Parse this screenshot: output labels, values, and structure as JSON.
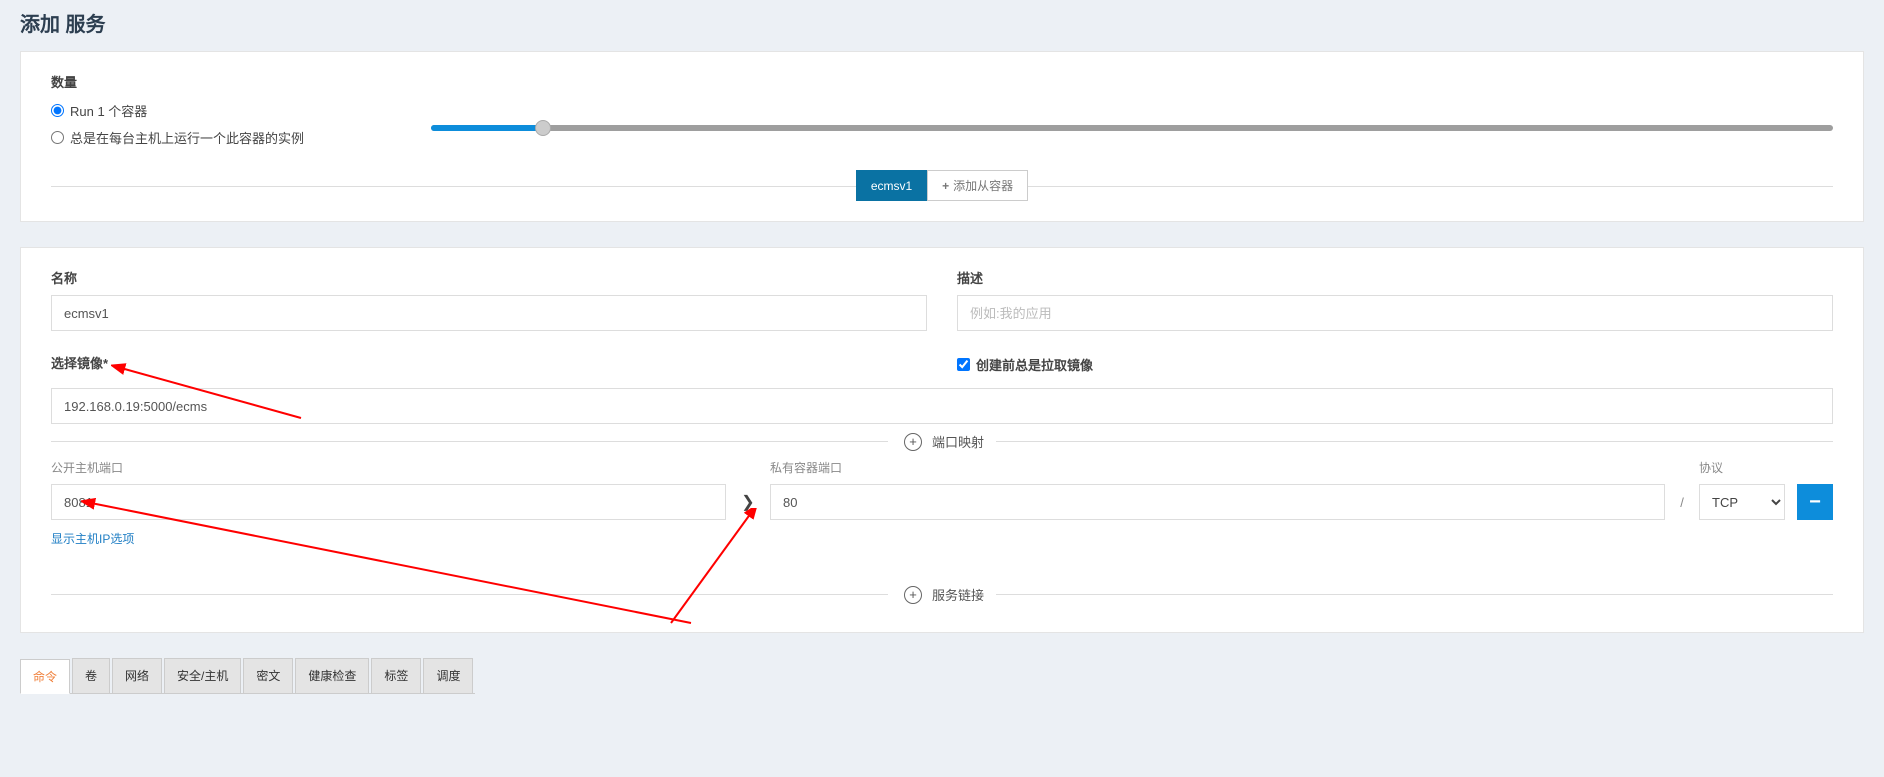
{
  "page_title": "添加 服务",
  "card1": {
    "qty_label": "数量",
    "radio_run_label": "Run 1 个容器",
    "radio_every_label": "总是在每台主机上运行一个此容器的实例",
    "slider_percent": 8,
    "pill_active": "ecmsv1",
    "pill_add": "添加从容器"
  },
  "card2": {
    "name_label": "名称",
    "name_value": "ecmsv1",
    "desc_label": "描述",
    "desc_placeholder": "例如:我的应用",
    "image_label": "选择镜像*",
    "image_value": "192.168.0.19:5000/ecms",
    "always_pull_label": "创建前总是拉取镜像",
    "port_map_label": "端口映射",
    "public_port_label": "公开主机端口",
    "public_port_value": "8081",
    "private_port_label": "私有容器端口",
    "private_port_value": "80",
    "proto_label": "协议",
    "proto_value": "TCP",
    "show_ip_options": "显示主机IP选项",
    "service_link_label": "服务链接"
  },
  "tabs": {
    "items": [
      "命令",
      "卷",
      "网络",
      "安全/主机",
      "密文",
      "健康检查",
      "标签",
      "调度"
    ],
    "active": 0
  }
}
